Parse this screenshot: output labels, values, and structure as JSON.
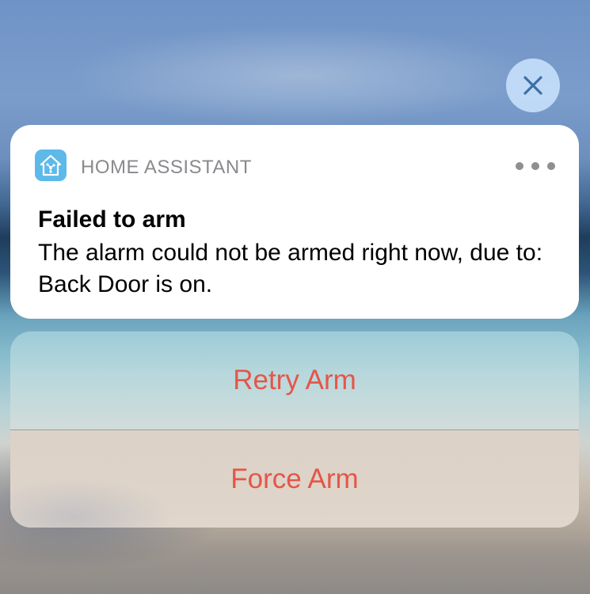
{
  "close_button": {
    "icon": "close-icon",
    "color": "#3d6fa6"
  },
  "notification": {
    "app_icon": "home-assistant-icon",
    "app_name": "HOME ASSISTANT",
    "more_icon": "ellipsis-icon",
    "title": "Failed to arm",
    "body": "The alarm could not be armed right now, due to: Back Door is on."
  },
  "actions": [
    {
      "label": "Retry Arm"
    },
    {
      "label": "Force Arm"
    }
  ],
  "colors": {
    "action_text": "#e4564a",
    "app_icon_bg": "#5db9ea"
  }
}
